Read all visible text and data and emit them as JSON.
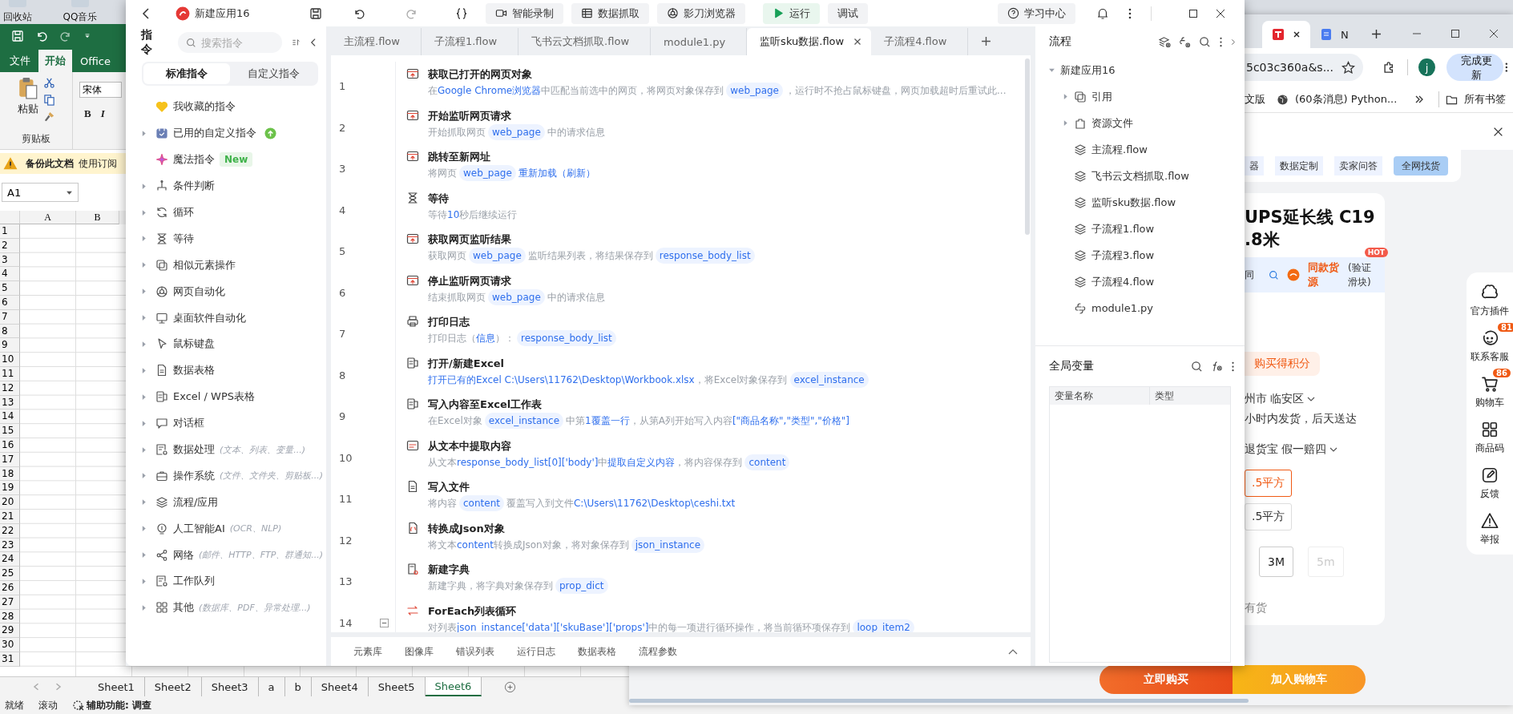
{
  "desktop": {
    "icons": [
      {
        "label": "回收站"
      },
      {
        "label": "QQ音乐"
      }
    ]
  },
  "excel": {
    "ribbon_tabs": [
      {
        "label": "文件",
        "selected": false
      },
      {
        "label": "开始",
        "selected": true
      },
      {
        "label": "Office",
        "selected": false
      }
    ],
    "paste": "粘贴",
    "clipboard_group": "剪贴板",
    "font": "宋体",
    "format_buttons": [
      "B",
      "I"
    ],
    "notice": {
      "title": "备份此文档",
      "text": "使用订阅"
    },
    "name_box": "A1",
    "columns": [
      "A",
      "B"
    ],
    "rows": [
      "1",
      "2",
      "3",
      "4",
      "5",
      "6",
      "7",
      "8",
      "9",
      "10",
      "11",
      "12",
      "13",
      "14",
      "15",
      "16",
      "17",
      "18",
      "19",
      "20",
      "21",
      "22",
      "23",
      "24",
      "25",
      "26",
      "27",
      "28",
      "29",
      "30",
      "31"
    ],
    "sheets": [
      {
        "label": "Sheet1",
        "selected": false
      },
      {
        "label": "Sheet2",
        "selected": false
      },
      {
        "label": "Sheet3",
        "selected": false
      },
      {
        "label": "a",
        "selected": false
      },
      {
        "label": "b",
        "selected": false
      },
      {
        "label": "Sheet4",
        "selected": false
      },
      {
        "label": "Sheet5",
        "selected": false
      },
      {
        "label": "Sheet6",
        "selected": true
      }
    ],
    "status": [
      {
        "label": "就绪",
        "kind": "text"
      },
      {
        "label": "滚动",
        "kind": "text"
      },
      {
        "label": "辅助功能: 调查",
        "kind": "accessibility"
      }
    ]
  },
  "browser": {
    "tabs": [
      {
        "kind": "site",
        "selected": true
      },
      {
        "kind": "doc",
        "label": "N",
        "selected": false
      }
    ],
    "address": "5c03c360a&s...",
    "avatar": "j",
    "update_button": "完成更新",
    "bookmarks": [
      {
        "label": "文版",
        "kind": "plain"
      },
      {
        "label": "(60条消息) Python...",
        "kind": "globe"
      }
    ],
    "all_bookmarks": "所有书签",
    "page": {
      "nav": [
        {
          "label": "器",
          "selected": false
        },
        {
          "label": "数据定制",
          "selected": false
        },
        {
          "label": "卖家问答",
          "selected": false
        },
        {
          "label": "全网找货",
          "selected": true
        }
      ],
      "title_lines": [
        "UPS延长线 C19",
        ".8米"
      ],
      "source": {
        "prefix": "同",
        "label": "同款货源",
        "note": "(验证滑块)",
        "badge": "HOT"
      },
      "points": "购买得积分",
      "location": "州市 临安区",
      "shipping": "小时内发货，后天送达",
      "guarantee": "退货宝 假一赔四",
      "specs": [
        {
          "label": ".5平方",
          "selected": true
        },
        {
          "label": ".5平方",
          "selected": false
        }
      ],
      "lengths": [
        {
          "label": "3M",
          "selected": false,
          "disabled": false
        },
        {
          "label": "5m",
          "selected": false,
          "disabled": true
        }
      ],
      "stock": "有货",
      "buy_now": "立即购买",
      "add_to_cart": "加入购物车"
    },
    "side_tools": [
      {
        "label": "官方插件",
        "kind": "plugin"
      },
      {
        "label": "联系客服",
        "kind": "service",
        "badge": "81"
      },
      {
        "label": "购物车",
        "kind": "cart",
        "badge": "86"
      },
      {
        "label": "商品码",
        "kind": "code"
      },
      {
        "label": "反馈",
        "kind": "feedback"
      },
      {
        "label": "举报",
        "kind": "report"
      }
    ]
  },
  "app": {
    "title": "新建应用16",
    "toolbar": [
      {
        "label": "智能录制",
        "kind": "record"
      },
      {
        "label": "数据抓取",
        "kind": "scrape"
      },
      {
        "label": "影刀浏览器",
        "kind": "browser"
      },
      {
        "label": "运行",
        "kind": "run"
      },
      {
        "label": "调试",
        "kind": "debug"
      }
    ],
    "help": "学习中心",
    "sidebar": {
      "title": "指令",
      "search": {
        "placeholder": "搜索指令"
      },
      "tabs": [
        {
          "label": "标准指令",
          "selected": true
        },
        {
          "label": "自定义指令",
          "selected": false
        }
      ],
      "items": [
        {
          "label": "我收藏的指令",
          "kind": "favorite"
        },
        {
          "label": "已用的自定义指令",
          "kind": "custom",
          "expanded": false
        },
        {
          "label": "魔法指令",
          "kind": "magic",
          "badge": "New"
        },
        {
          "label": "条件判断",
          "kind": "category",
          "expanded": false
        },
        {
          "label": "循环",
          "kind": "category",
          "expanded": false
        },
        {
          "label": "等待",
          "kind": "category",
          "expanded": false
        },
        {
          "label": "相似元素操作",
          "kind": "category",
          "expanded": false
        },
        {
          "label": "网页自动化",
          "kind": "category",
          "expanded": false
        },
        {
          "label": "桌面软件自动化",
          "kind": "category",
          "expanded": false
        },
        {
          "label": "鼠标键盘",
          "kind": "category",
          "expanded": false
        },
        {
          "label": "数据表格",
          "kind": "category",
          "expanded": false
        },
        {
          "label": "Excel / WPS表格",
          "kind": "category",
          "expanded": false
        },
        {
          "label": "对话框",
          "kind": "category",
          "expanded": false
        },
        {
          "label": "数据处理",
          "kind": "category",
          "expanded": false,
          "hint": "(文本、列表、变量...)"
        },
        {
          "label": "操作系统",
          "kind": "category",
          "expanded": false,
          "hint": "(文件、文件夹、剪贴板...)"
        },
        {
          "label": "流程/应用",
          "kind": "category",
          "expanded": false
        },
        {
          "label": "人工智能AI",
          "kind": "category",
          "expanded": false,
          "hint": "(OCR、NLP)"
        },
        {
          "label": "网络",
          "kind": "category",
          "expanded": false,
          "hint": "(邮件、HTTP、FTP、群通知...)"
        },
        {
          "label": "工作队列",
          "kind": "category",
          "expanded": false
        },
        {
          "label": "其他",
          "kind": "category",
          "expanded": false,
          "hint": "(数据库、PDF、异常处理...)"
        }
      ]
    },
    "editor": {
      "tabs": [
        {
          "label": "主流程.flow",
          "selected": false
        },
        {
          "label": "子流程1.flow",
          "selected": false
        },
        {
          "label": "飞书云文档抓取.flow",
          "selected": false
        },
        {
          "label": "module1.py",
          "selected": false
        },
        {
          "label": "监听sku数据.flow",
          "selected": true
        },
        {
          "label": "子流程4.flow",
          "selected": false
        }
      ],
      "steps": [
        {
          "number": "1",
          "title": "获取已打开的网页对象",
          "desc": [
            {
              "kind": "text",
              "text": "在"
            },
            {
              "kind": "link",
              "text": "Google Chrome浏览器"
            },
            {
              "kind": "text",
              "text": "中匹配当前选中的网页，将网页对象保存到"
            },
            {
              "kind": "var",
              "text": "web_page"
            },
            {
              "kind": "text",
              "text": "，运行时不抢占鼠标键盘，网页加载超时后重试此..."
            }
          ]
        },
        {
          "number": "2",
          "title": "开始监听网页请求",
          "desc": [
            {
              "kind": "text",
              "text": "开始抓取网页"
            },
            {
              "kind": "var",
              "text": "web_page"
            },
            {
              "kind": "text",
              "text": "中的请求信息"
            }
          ]
        },
        {
          "number": "3",
          "title": "跳转至新网址",
          "desc": [
            {
              "kind": "text",
              "text": "将网页"
            },
            {
              "kind": "var",
              "text": "web_page"
            },
            {
              "kind": "link",
              "text": "重新加载（刷新）"
            }
          ]
        },
        {
          "number": "4",
          "title": "等待",
          "desc": [
            {
              "kind": "text",
              "text": "等待"
            },
            {
              "kind": "link",
              "text": "10"
            },
            {
              "kind": "text",
              "text": "秒后继续运行"
            }
          ]
        },
        {
          "number": "5",
          "title": "获取网页监听结果",
          "desc": [
            {
              "kind": "text",
              "text": "获取网页"
            },
            {
              "kind": "var",
              "text": "web_page"
            },
            {
              "kind": "text",
              "text": "监听结果列表，将结果保存到"
            },
            {
              "kind": "var",
              "text": "response_body_list"
            }
          ]
        },
        {
          "number": "6",
          "title": "停止监听网页请求",
          "desc": [
            {
              "kind": "text",
              "text": "结束抓取网页"
            },
            {
              "kind": "var",
              "text": "web_page"
            },
            {
              "kind": "text",
              "text": "中的请求信息"
            }
          ]
        },
        {
          "number": "7",
          "title": "打印日志",
          "desc": [
            {
              "kind": "text",
              "text": "打印日志（"
            },
            {
              "kind": "link",
              "text": "信息"
            },
            {
              "kind": "text",
              "text": "）："
            },
            {
              "kind": "var",
              "text": "response_body_list"
            }
          ]
        },
        {
          "number": "8",
          "title": "打开/新建Excel",
          "desc": [
            {
              "kind": "link",
              "text": "打开已有的Excel C:\\Users\\11762\\Desktop\\Workbook.xlsx"
            },
            {
              "kind": "text",
              "text": "，将Excel对象保存到"
            },
            {
              "kind": "var",
              "text": "excel_instance"
            }
          ]
        },
        {
          "number": "9",
          "title": "写入内容至Excel工作表",
          "desc": [
            {
              "kind": "text",
              "text": "在Excel对象"
            },
            {
              "kind": "var",
              "text": "excel_instance"
            },
            {
              "kind": "text",
              "text": "中第"
            },
            {
              "kind": "link",
              "text": "1覆盖一行"
            },
            {
              "kind": "text",
              "text": "，从第A列开始写入内容"
            },
            {
              "kind": "link",
              "text": "[\"商品名称\",\"类型\",\"价格\"]"
            }
          ]
        },
        {
          "number": "10",
          "title": "从文本中提取内容",
          "desc": [
            {
              "kind": "text",
              "text": "从文本"
            },
            {
              "kind": "link",
              "text": "response_body_list[0]['body']"
            },
            {
              "kind": "text",
              "text": "中"
            },
            {
              "kind": "link",
              "text": "提取自定义内容"
            },
            {
              "kind": "text",
              "text": "，将内容保存到"
            },
            {
              "kind": "var",
              "text": "content"
            }
          ]
        },
        {
          "number": "11",
          "title": "写入文件",
          "desc": [
            {
              "kind": "text",
              "text": "将内容"
            },
            {
              "kind": "var",
              "text": "content"
            },
            {
              "kind": "text",
              "text": "覆盖写入到文件"
            },
            {
              "kind": "link",
              "text": "C:\\Users\\11762\\Desktop\\ceshi.txt"
            }
          ]
        },
        {
          "number": "12",
          "title": "转换成Json对象",
          "desc": [
            {
              "kind": "text",
              "text": "将文本"
            },
            {
              "kind": "link",
              "text": "content"
            },
            {
              "kind": "text",
              "text": "转换成Json对象，将对象保存到"
            },
            {
              "kind": "var",
              "text": "json_instance"
            }
          ]
        },
        {
          "number": "13",
          "title": "新建字典",
          "desc": [
            {
              "kind": "text",
              "text": "新建字典，将字典对象保存到"
            },
            {
              "kind": "var",
              "text": "prop_dict"
            }
          ]
        },
        {
          "number": "14",
          "title": "ForEach列表循环",
          "expanded": true,
          "desc": [
            {
              "kind": "text",
              "text": "对列表"
            },
            {
              "kind": "link",
              "text": "json_instance['data']['skuBase']['props']"
            },
            {
              "kind": "text",
              "text": "中的每一项进行循环操作，将当前循环项保存到"
            },
            {
              "kind": "var",
              "text": "loop_item2"
            }
          ]
        }
      ],
      "bottom_tabs": [
        "元素库",
        "图像库",
        "错误列表",
        "运行日志",
        "数据表格",
        "流程参数"
      ]
    },
    "flow_panel": {
      "title": "流程",
      "tree": [
        {
          "label": "新建应用16",
          "expanded": true,
          "children": [
            {
              "label": "引用",
              "kind": "reference",
              "expanded": false
            },
            {
              "label": "资源文件",
              "kind": "resources",
              "expanded": false
            },
            {
              "label": "主流程.flow",
              "kind": "flow"
            },
            {
              "label": "飞书云文档抓取.flow",
              "kind": "flow"
            },
            {
              "label": "监听sku数据.flow",
              "kind": "flow"
            },
            {
              "label": "子流程1.flow",
              "kind": "flow"
            },
            {
              "label": "子流程3.flow",
              "kind": "flow"
            },
            {
              "label": "子流程4.flow",
              "kind": "flow"
            },
            {
              "label": "module1.py",
              "kind": "python"
            }
          ]
        }
      ]
    },
    "variables": {
      "title": "全局变量",
      "columns": [
        "变量名称",
        "类型"
      ]
    }
  }
}
